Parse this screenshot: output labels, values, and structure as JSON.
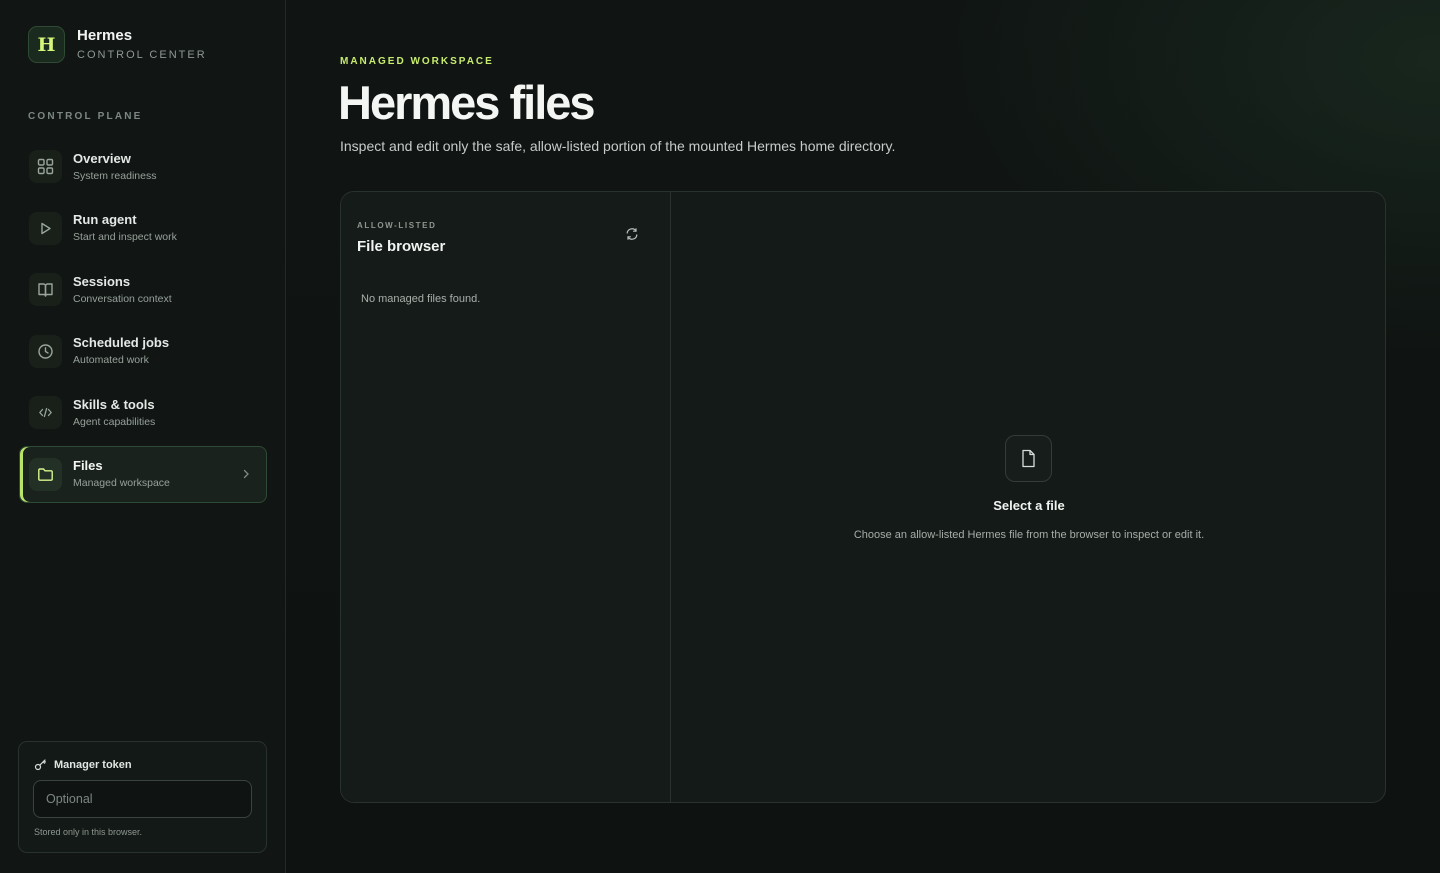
{
  "brand": {
    "logo_letter": "H",
    "name": "Hermes",
    "subtitle": "CONTROL CENTER"
  },
  "sidebar": {
    "section_label": "CONTROL PLANE",
    "items": [
      {
        "label": "Overview",
        "description": "System readiness",
        "icon": "grid-icon"
      },
      {
        "label": "Run agent",
        "description": "Start and inspect work",
        "icon": "play-icon"
      },
      {
        "label": "Sessions",
        "description": "Conversation context",
        "icon": "book-icon"
      },
      {
        "label": "Scheduled jobs",
        "description": "Automated work",
        "icon": "clock-icon"
      },
      {
        "label": "Skills & tools",
        "description": "Agent capabilities",
        "icon": "code-icon"
      },
      {
        "label": "Files",
        "description": "Managed workspace",
        "icon": "folder-icon",
        "active": true
      }
    ],
    "token": {
      "title": "Manager token",
      "value": "",
      "placeholder": "Optional",
      "note": "Stored only in this browser."
    }
  },
  "main": {
    "eyebrow": "MANAGED WORKSPACE",
    "title": "Hermes files",
    "description": "Inspect and edit only the safe, allow-listed portion of the mounted Hermes home directory.",
    "browser": {
      "eyebrow": "ALLOW-LISTED",
      "title": "File browser",
      "empty_text": "No managed files found."
    },
    "viewer": {
      "title": "Select a file",
      "description": "Choose an allow-listed Hermes file from the browser to inspect or edit it."
    }
  },
  "colors": {
    "accent": "#c8ec6e",
    "background": "#0f1311",
    "panel": "#141a17"
  }
}
